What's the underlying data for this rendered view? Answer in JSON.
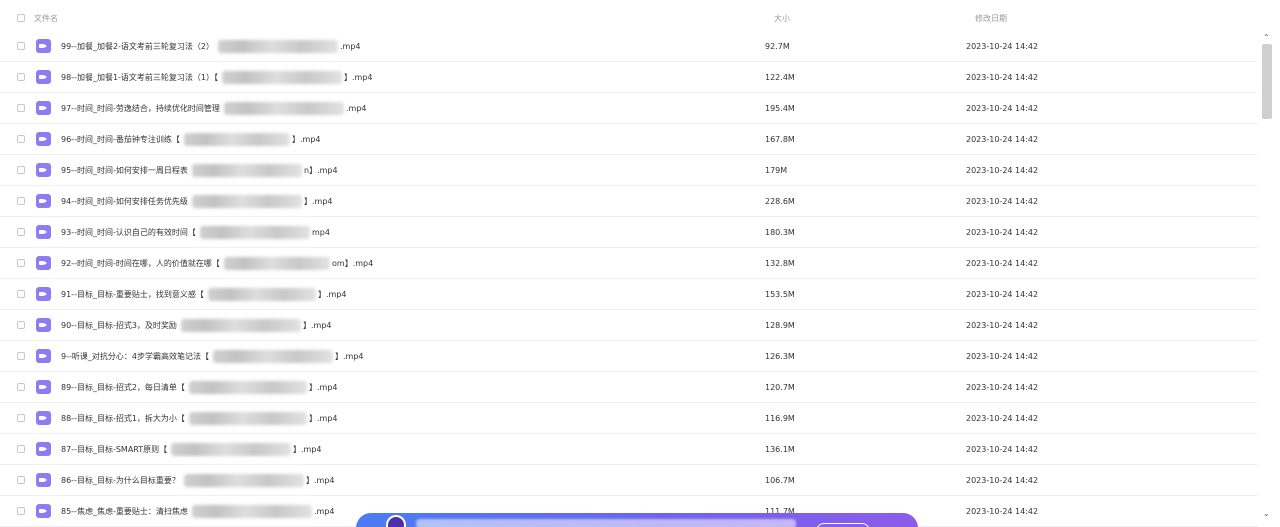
{
  "header": {
    "name_label": "文件名",
    "size_label": "大小",
    "date_label": "修改日期"
  },
  "files": [
    {
      "name": "99--加餐_加餐2-语文考前三轮复习法（2）",
      "ext": ".mp4",
      "size": "92.7M",
      "date": "2023-10-24 14:42"
    },
    {
      "name": "98--加餐_加餐1-语文考前三轮复习法（1）【",
      "ext": "】.mp4",
      "size": "122.4M",
      "date": "2023-10-24 14:42"
    },
    {
      "name": "97--时间_时间-劳逸结合，持续优化时间管理",
      "ext": ".mp4",
      "size": "195.4M",
      "date": "2023-10-24 14:42"
    },
    {
      "name": "96--时间_时间-番茄钟专注训练【",
      "ext": "】.mp4",
      "size": "167.8M",
      "date": "2023-10-24 14:42"
    },
    {
      "name": "95--时间_时间-如何安排一周日程表",
      "ext": "n】.mp4",
      "size": "179M",
      "date": "2023-10-24 14:42"
    },
    {
      "name": "94--时间_时间-如何安排任务优先级",
      "ext": "】.mp4",
      "size": "228.6M",
      "date": "2023-10-24 14:42"
    },
    {
      "name": "93--时间_时间-认识自己的有效时间【",
      "ext": "mp4",
      "size": "180.3M",
      "date": "2023-10-24 14:42"
    },
    {
      "name": "92--时间_时间-时间在哪，人的价值就在哪【",
      "ext": "om】.mp4",
      "size": "132.8M",
      "date": "2023-10-24 14:42"
    },
    {
      "name": "91--目标_目标-重要贴士，找到意义感【",
      "ext": "】.mp4",
      "size": "153.5M",
      "date": "2023-10-24 14:42"
    },
    {
      "name": "90--目标_目标-招式3，及时奖励",
      "ext": "】.mp4",
      "size": "128.9M",
      "date": "2023-10-24 14:42"
    },
    {
      "name": "9--听课_对抗分心：4步学霸高效笔记法【",
      "ext": "】.mp4",
      "size": "126.3M",
      "date": "2023-10-24 14:42"
    },
    {
      "name": "89--目标_目标-招式2，每日清单【",
      "ext": "】.mp4",
      "size": "120.7M",
      "date": "2023-10-24 14:42"
    },
    {
      "name": "88--目标_目标-招式1，拆大为小【",
      "ext": "】.mp4",
      "size": "116.9M",
      "date": "2023-10-24 14:42"
    },
    {
      "name": "87--目标_目标-SMART原则【",
      "ext": "】.mp4",
      "size": "136.1M",
      "date": "2023-10-24 14:42"
    },
    {
      "name": "86--目标_目标-为什么目标重要？",
      "ext": "】.mp4",
      "size": "106.7M",
      "date": "2023-10-24 14:42"
    },
    {
      "name": "85--焦虑_焦虑-重要贴士：清扫焦虑",
      "ext": ".mp4",
      "size": "111.7M",
      "date": "2023-10-24 14:42"
    }
  ],
  "icons": {
    "file_type": "video-file-icon",
    "scroll_up": "chevron-up-icon",
    "scroll_down": "chevron-down-icon"
  },
  "colors": {
    "video_icon": "#8d7df3",
    "banner_start": "#4a7cf3",
    "banner_end": "#8c5cea"
  }
}
